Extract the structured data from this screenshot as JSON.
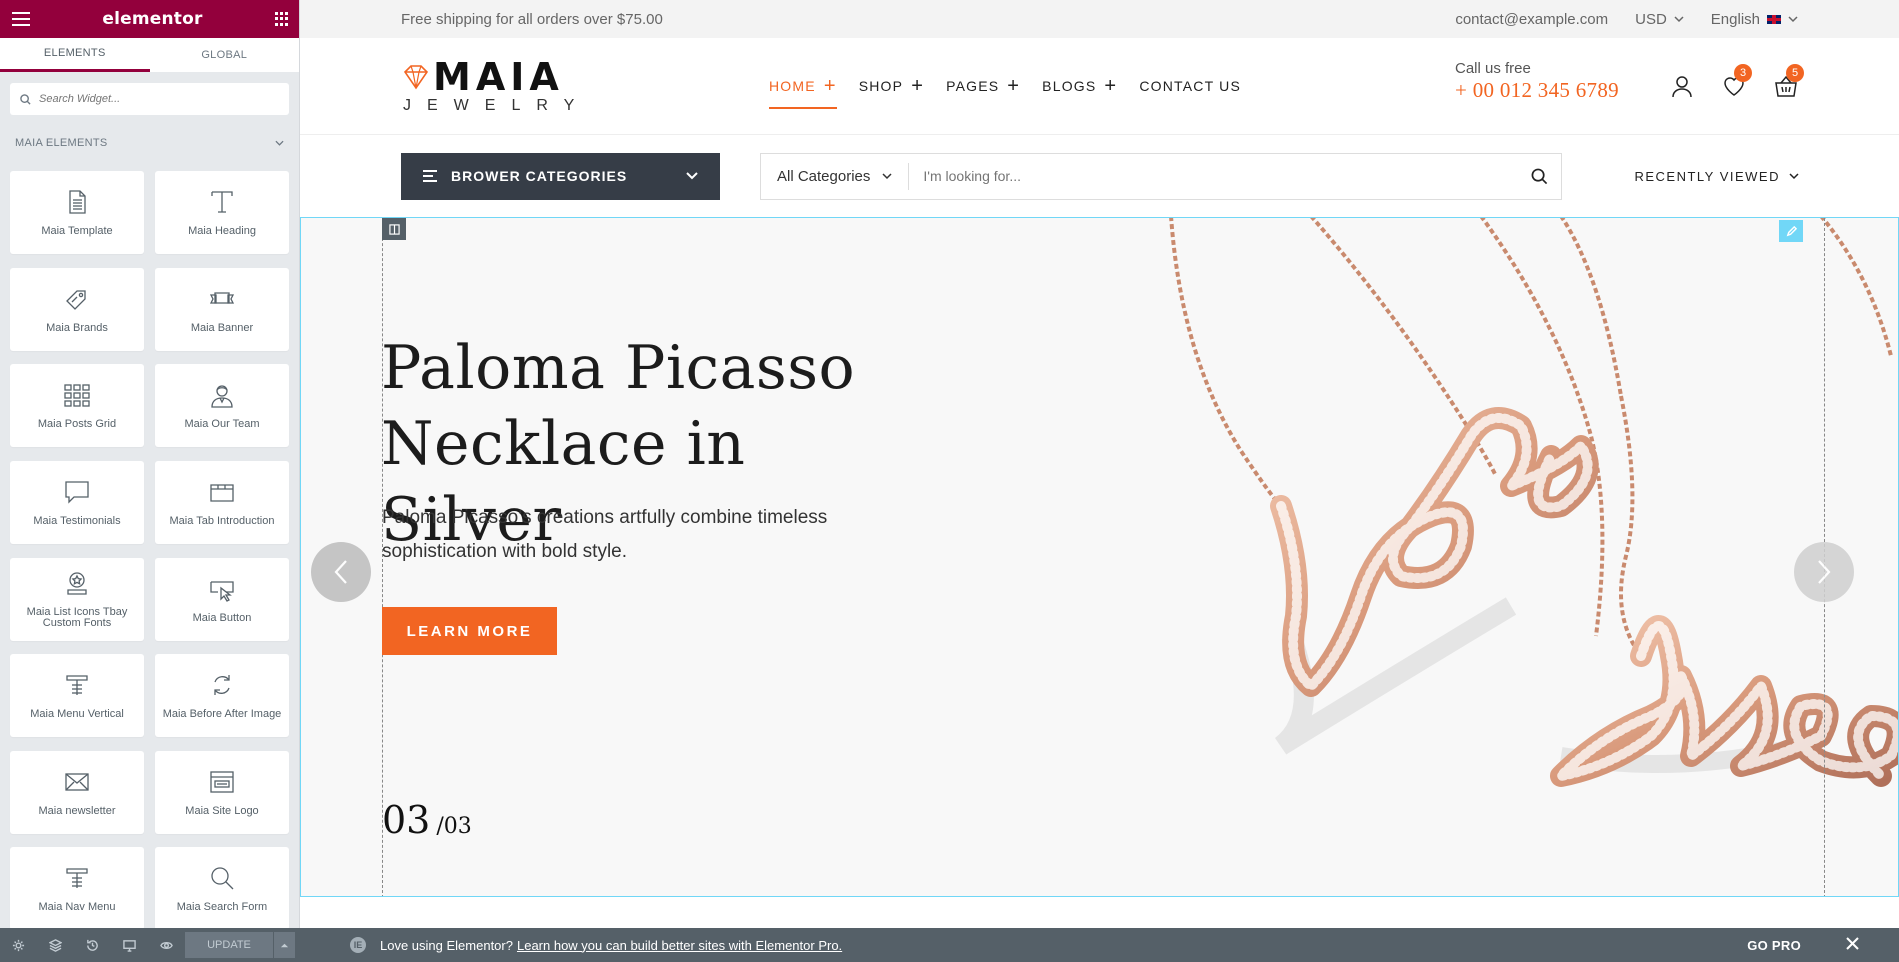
{
  "panel": {
    "brand": "elementor",
    "tabs": [
      {
        "label": "ELEMENTS"
      },
      {
        "label": "GLOBAL"
      }
    ],
    "search_placeholder": "Search Widget...",
    "category": "MAIA ELEMENTS",
    "widgets": [
      {
        "label": "Maia Template",
        "icon": "document-icon"
      },
      {
        "label": "Maia Heading",
        "icon": "heading-icon"
      },
      {
        "label": "Maia Brands",
        "icon": "tag-icon"
      },
      {
        "label": "Maia Banner",
        "icon": "banner-icon"
      },
      {
        "label": "Maia Posts Grid",
        "icon": "posts-grid-icon"
      },
      {
        "label": "Maia Our Team",
        "icon": "team-member-icon"
      },
      {
        "label": "Maia Testimonials",
        "icon": "speech-bubble-icon"
      },
      {
        "label": "Maia Tab Introduction",
        "icon": "tabs-icon"
      },
      {
        "label": "Maia List Icons Tbay Custom Fonts",
        "icon": "icon-list-icon"
      },
      {
        "label": "Maia Button",
        "icon": "button-icon"
      },
      {
        "label": "Maia Menu Vertical",
        "icon": "menu-vertical-icon"
      },
      {
        "label": "Maia Before After Image",
        "icon": "refresh-icon"
      },
      {
        "label": "Maia newsletter",
        "icon": "envelope-icon"
      },
      {
        "label": "Maia Site Logo",
        "icon": "site-logo-icon"
      },
      {
        "label": "Maia Nav Menu",
        "icon": "nav-menu-icon"
      },
      {
        "label": "Maia Search Form",
        "icon": "search-icon"
      }
    ],
    "footer": {
      "update_label": "UPDATE"
    }
  },
  "site": {
    "topbar": {
      "shipping": "Free shipping for all orders over $75.00",
      "email": "contact@example.com",
      "currency": "USD",
      "language": "English"
    },
    "logo": {
      "brand": "MAIA",
      "sub": "JEWELRY"
    },
    "nav": [
      {
        "label": "HOME",
        "active": true,
        "has_sub": true
      },
      {
        "label": "SHOP",
        "active": false,
        "has_sub": true
      },
      {
        "label": "PAGES",
        "active": false,
        "has_sub": true
      },
      {
        "label": "BLOGS",
        "active": false,
        "has_sub": true
      },
      {
        "label": "CONTACT US",
        "active": false,
        "has_sub": false
      }
    ],
    "call": {
      "label": "Call us free",
      "phone": "+ 00 012 345 6789"
    },
    "wishlist_count": "3",
    "cart_count": "5",
    "categories_button": "BROWER CATEGORIES",
    "search": {
      "category": "All Categories",
      "placeholder": "I'm looking for..."
    },
    "recently_viewed": "RECENTLY VIEWED",
    "hero": {
      "title_line1": "Paloma Picasso",
      "title_line2": "Necklace in Silver",
      "description": "Paloma Picasso’s creations artfully combine timeless sophistication with bold style.",
      "button": "LEARN MORE",
      "slide_current": "03",
      "slide_total": "/03"
    }
  },
  "notice": {
    "text": "Love using Elementor?",
    "link": "Learn how you can build better sites with Elementor Pro.",
    "gopro": "GO PRO"
  },
  "colors": {
    "elementor": "#93003c",
    "accent": "#f26522",
    "dark": "#363d47",
    "panel_bg": "#e6e9ec",
    "selection": "#71d7f7"
  }
}
